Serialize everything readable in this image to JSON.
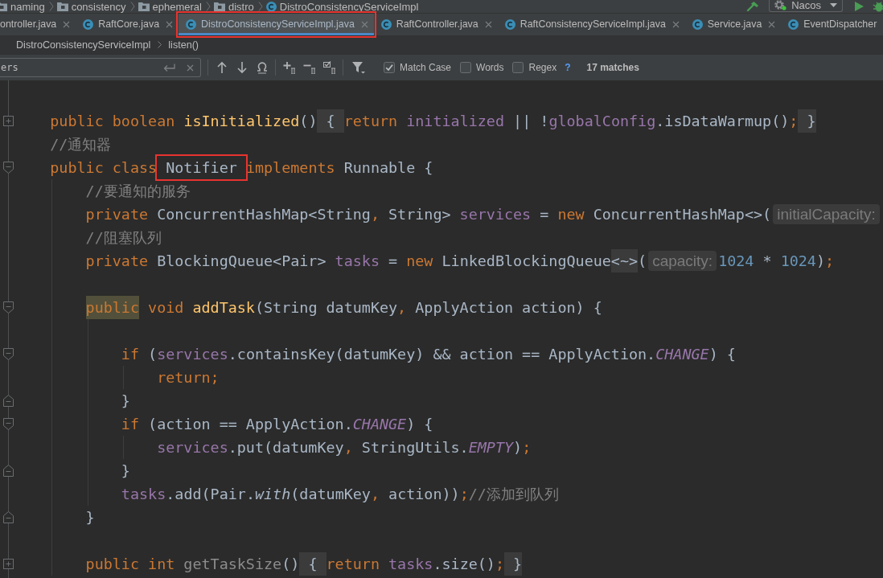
{
  "nav_bar": {
    "path": [
      {
        "kind": "folder",
        "label": "naming"
      },
      {
        "kind": "folder",
        "label": "consistency"
      },
      {
        "kind": "folder",
        "label": "ephemeral"
      },
      {
        "kind": "folder",
        "label": "distro"
      },
      {
        "kind": "class",
        "label": "DistroConsistencyServiceImpl"
      }
    ],
    "run_config": {
      "label": "Nacos"
    }
  },
  "tabs": [
    {
      "label": "ontroller.java",
      "icon": false,
      "selected": false,
      "outlined": false,
      "close_button": true
    },
    {
      "label": "RaftCore.java",
      "icon": true,
      "selected": false,
      "outlined": false,
      "close_button": true
    },
    {
      "label": "DistroConsistencyServiceImpl.java",
      "icon": true,
      "selected": true,
      "outlined": true,
      "close_button": true
    },
    {
      "label": "RaftController.java",
      "icon": true,
      "selected": false,
      "outlined": false,
      "close_button": true
    },
    {
      "label": "RaftConsistencyServiceImpl.java",
      "icon": true,
      "selected": false,
      "outlined": false,
      "close_button": true
    },
    {
      "label": "Service.java",
      "icon": true,
      "selected": false,
      "outlined": false,
      "close_button": true
    },
    {
      "label": "EventDispatcher",
      "icon": true,
      "selected": false,
      "outlined": false,
      "close_button": false
    }
  ],
  "breadcrumbs": [
    "DistroConsistencyServiceImpl",
    "listen()"
  ],
  "find_bar": {
    "query": "ers",
    "options": [
      {
        "label": "Match Case",
        "checked": true
      },
      {
        "label": "Words",
        "checked": false
      },
      {
        "label": "Regex",
        "checked": false
      }
    ],
    "help": "?",
    "result": "17 matches"
  },
  "editor": {
    "lines": [
      {
        "kind": "code",
        "fold_marker": {
          "kind": "collapsed"
        },
        "segments": [
          {
            "kind": "keyword",
            "text": "public boolean "
          },
          {
            "kind": "declaration",
            "text": "isInitialized"
          },
          {
            "kind": "plain",
            "text": "()"
          },
          {
            "kind": "placeholder",
            "text": " { "
          },
          {
            "kind": "keyword",
            "text": "return "
          },
          {
            "kind": "field",
            "text": "initialized"
          },
          {
            "kind": "plain",
            "text": " || !"
          },
          {
            "kind": "field",
            "text": "globalConfig"
          },
          {
            "kind": "plain",
            "text": ".isDataWarmup()"
          },
          {
            "kind": "keyword",
            "text": ";"
          },
          {
            "kind": "placeholder",
            "text": " }"
          }
        ]
      },
      {
        "kind": "code",
        "segments": [
          {
            "kind": "comment",
            "text": "//通知器"
          }
        ]
      },
      {
        "kind": "code",
        "fold_marker": {
          "kind": "start"
        },
        "segments": [
          {
            "kind": "keyword",
            "text": "public class"
          },
          {
            "kind": "annotated",
            "text": " Notifier "
          },
          {
            "kind": "keyword",
            "text": "implements "
          },
          {
            "kind": "plain",
            "text": "Runnable {"
          }
        ],
        "children": [
          {
            "kind": "code",
            "segments": [
              {
                "kind": "comment",
                "text": "//要通知的服务"
              }
            ]
          },
          {
            "kind": "code",
            "segments": [
              {
                "kind": "keyword",
                "text": "private "
              },
              {
                "kind": "plain",
                "text": "ConcurrentHashMap<String"
              },
              {
                "kind": "keyword",
                "text": ","
              },
              {
                "kind": "plain",
                "text": " String> "
              },
              {
                "kind": "field",
                "text": "services"
              },
              {
                "kind": "plain",
                "text": " = "
              },
              {
                "kind": "keyword",
                "text": "new "
              },
              {
                "kind": "plain",
                "text": "ConcurrentHashMap<>("
              },
              {
                "kind": "hint",
                "text": "initialCapacity:"
              }
            ]
          },
          {
            "kind": "code",
            "segments": [
              {
                "kind": "comment",
                "text": "//阻塞队列"
              }
            ]
          },
          {
            "kind": "code",
            "segments": [
              {
                "kind": "keyword",
                "text": "private "
              },
              {
                "kind": "plain",
                "text": "BlockingQueue<Pair> "
              },
              {
                "kind": "field",
                "text": "tasks"
              },
              {
                "kind": "plain",
                "text": " = "
              },
              {
                "kind": "keyword",
                "text": "new "
              },
              {
                "kind": "plain",
                "text": "LinkedBlockingQueue"
              },
              {
                "kind": "placeholder",
                "text": "<~>"
              },
              {
                "kind": "plain",
                "text": "("
              },
              {
                "kind": "hint",
                "text": "capacity:"
              },
              {
                "kind": "number",
                "text": "1024"
              },
              {
                "kind": "plain",
                "text": " * "
              },
              {
                "kind": "number",
                "text": "1024"
              },
              {
                "kind": "plain",
                "text": ")"
              },
              {
                "kind": "keyword",
                "text": ";"
              }
            ]
          },
          {
            "kind": "blank"
          },
          {
            "kind": "code",
            "fold_marker": {
              "kind": "start"
            },
            "segments": [
              {
                "kind": "occurrence",
                "text": "public"
              },
              {
                "kind": "keyword",
                "text": " void "
              },
              {
                "kind": "declaration",
                "text": "addTask"
              },
              {
                "kind": "plain",
                "text": "(String datumKey"
              },
              {
                "kind": "keyword",
                "text": ","
              },
              {
                "kind": "plain",
                "text": " ApplyAction action) {"
              }
            ],
            "children": [
              {
                "kind": "blank"
              },
              {
                "kind": "code",
                "fold_marker": {
                  "kind": "start"
                },
                "segments": [
                  {
                    "kind": "keyword",
                    "text": "if "
                  },
                  {
                    "kind": "plain",
                    "text": "("
                  },
                  {
                    "kind": "field",
                    "text": "services"
                  },
                  {
                    "kind": "plain",
                    "text": ".containsKey(datumKey) && action == ApplyAction."
                  },
                  {
                    "kind": "static",
                    "text": "CHANGE"
                  },
                  {
                    "kind": "plain",
                    "text": ") {"
                  }
                ],
                "children": [
                  {
                    "kind": "code",
                    "segments": [
                      {
                        "kind": "keyword",
                        "text": "return;"
                      }
                    ]
                  }
                ]
              },
              {
                "kind": "code",
                "fold_marker": {
                  "kind": "end"
                },
                "segments": [
                  {
                    "kind": "plain",
                    "text": "}"
                  }
                ]
              },
              {
                "kind": "code",
                "fold_marker": {
                  "kind": "start"
                },
                "segments": [
                  {
                    "kind": "keyword",
                    "text": "if "
                  },
                  {
                    "kind": "plain",
                    "text": "(action == ApplyAction."
                  },
                  {
                    "kind": "static",
                    "text": "CHANGE"
                  },
                  {
                    "kind": "plain",
                    "text": ") {"
                  }
                ],
                "children": [
                  {
                    "kind": "code",
                    "segments": [
                      {
                        "kind": "field",
                        "text": "services"
                      },
                      {
                        "kind": "plain",
                        "text": ".put(datumKey"
                      },
                      {
                        "kind": "keyword",
                        "text": ","
                      },
                      {
                        "kind": "plain",
                        "text": " StringUtils."
                      },
                      {
                        "kind": "static",
                        "text": "EMPTY"
                      },
                      {
                        "kind": "plain",
                        "text": ")"
                      },
                      {
                        "kind": "keyword",
                        "text": ";"
                      }
                    ]
                  }
                ]
              },
              {
                "kind": "code",
                "fold_marker": {
                  "kind": "end"
                },
                "segments": [
                  {
                    "kind": "plain",
                    "text": "}"
                  }
                ]
              },
              {
                "kind": "code",
                "segments": [
                  {
                    "kind": "field",
                    "text": "tasks"
                  },
                  {
                    "kind": "plain",
                    "text": ".add(Pair."
                  },
                  {
                    "kind": "call",
                    "text": "with"
                  },
                  {
                    "kind": "plain",
                    "text": "(datumKey"
                  },
                  {
                    "kind": "keyword",
                    "text": ","
                  },
                  {
                    "kind": "plain",
                    "text": " action))"
                  },
                  {
                    "kind": "keyword",
                    "text": ";"
                  },
                  {
                    "kind": "comment",
                    "text": "//添加到队列"
                  }
                ]
              }
            ]
          },
          {
            "kind": "code",
            "fold_marker": {
              "kind": "end"
            },
            "segments": [
              {
                "kind": "plain",
                "text": "}"
              }
            ]
          },
          {
            "kind": "blank"
          },
          {
            "kind": "code",
            "fold_marker": {
              "kind": "collapsed"
            },
            "segments": [
              {
                "kind": "keyword",
                "text": "public int "
              },
              {
                "kind": "unused",
                "text": "getTaskSize"
              },
              {
                "kind": "plain",
                "text": "()"
              },
              {
                "kind": "placeholder",
                "text": " { "
              },
              {
                "kind": "keyword",
                "text": "return "
              },
              {
                "kind": "field",
                "text": "tasks"
              },
              {
                "kind": "plain",
                "text": ".size()"
              },
              {
                "kind": "keyword",
                "text": ";"
              },
              {
                "kind": "placeholder",
                "text": " }"
              }
            ]
          }
        ]
      }
    ]
  }
}
